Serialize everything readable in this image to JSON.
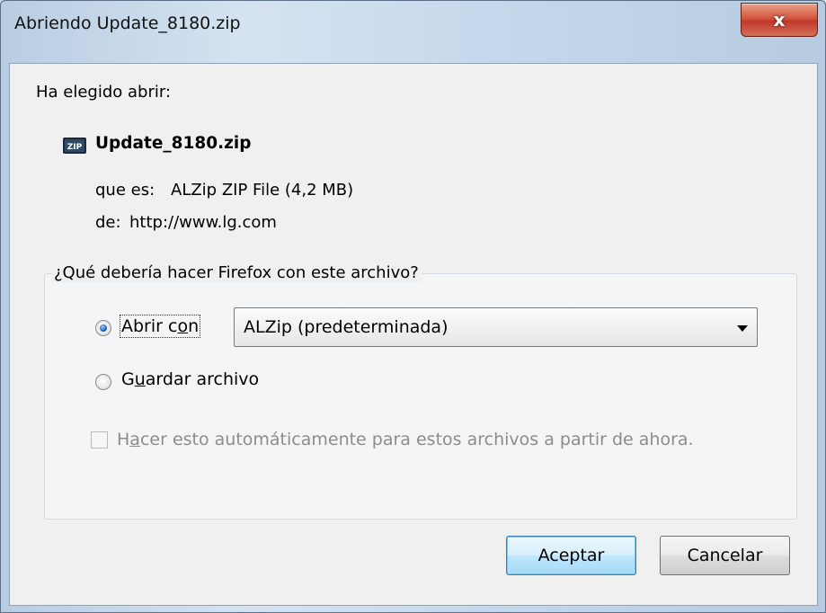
{
  "window": {
    "title": "Abriendo Update_8180.zip",
    "close_glyph": "x"
  },
  "intro": "Ha elegido abrir:",
  "file": {
    "icon": "zip-file-icon",
    "name": "Update_8180.zip",
    "type_label": "que es:",
    "type_value": "ALZip ZIP File (4,2 MB)",
    "from_label": "de:",
    "from_value": "http://www.lg.com"
  },
  "question": "¿Qué debería hacer Firefox con este archivo?",
  "options": {
    "open_with": {
      "label_pre": "Abrir c",
      "label_accel": "o",
      "label_post": "n",
      "selected": true
    },
    "app_select": {
      "value": "ALZip (predeterminada)"
    },
    "save_file": {
      "label_pre": "G",
      "label_accel": "u",
      "label_post": "ardar archivo",
      "selected": false
    },
    "auto": {
      "label_pre": "H",
      "label_accel": "a",
      "label_post": "cer esto automáticamente para estos archivos a partir de ahora.",
      "checked": false,
      "enabled": false
    }
  },
  "buttons": {
    "ok": "Aceptar",
    "cancel": "Cancelar"
  },
  "colors": {
    "title_bar": "#c5d8eb",
    "close_button": "#c0392b",
    "client_bg": "#f0f0f0",
    "default_button": "#bee6fd"
  }
}
